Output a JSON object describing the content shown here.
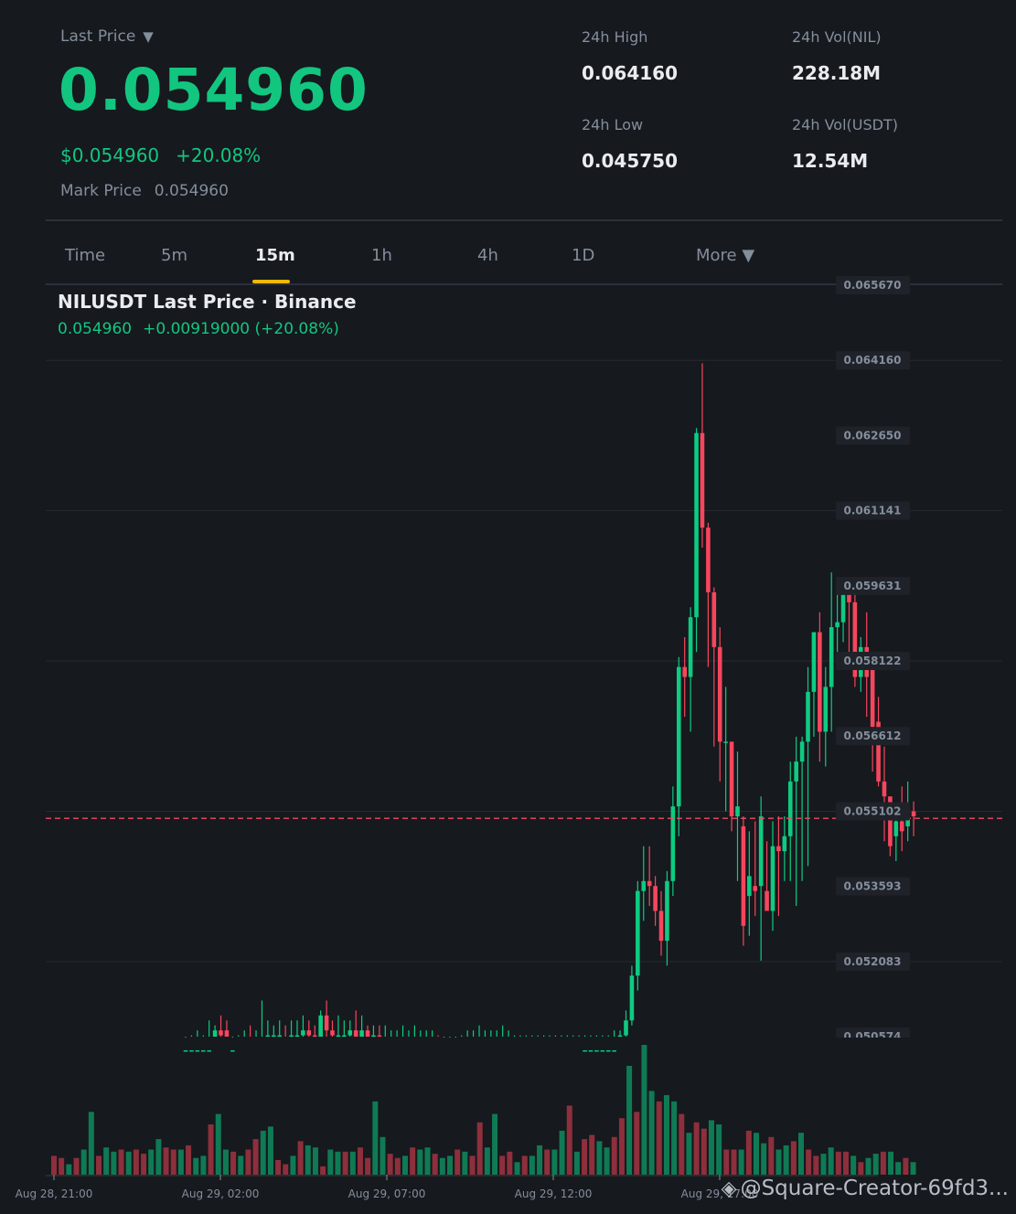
{
  "header": {
    "last_price_label": "Last Price",
    "last_price_caret": "▼",
    "last_price": "0.054960",
    "usd_price": "$0.054960",
    "change_pct": "+20.08%",
    "mark_label": "Mark Price",
    "mark_value": "0.054960",
    "stats": [
      {
        "label": "24h High",
        "value": "0.064160"
      },
      {
        "label": "24h Vol(NIL)",
        "value": "228.18M"
      },
      {
        "label": "24h Low",
        "value": "0.045750"
      },
      {
        "label": "24h Vol(USDT)",
        "value": "12.54M"
      }
    ]
  },
  "tabs": [
    {
      "label": "Time"
    },
    {
      "label": "5m"
    },
    {
      "label": "15m"
    },
    {
      "label": "1h"
    },
    {
      "label": "4h"
    },
    {
      "label": "1D"
    },
    {
      "label": "More ▼"
    }
  ],
  "active_tab": "15m",
  "chart": {
    "title": "NILUSDT Last Price · Binance",
    "last": "0.054960",
    "change": "+0.00919000 (+20.08%)"
  },
  "watermark": "@Square-Creator-69fd3...",
  "colors": {
    "up": "#0ecb81",
    "down": "#f6465d",
    "bg": "#16191e",
    "accent": "#f0b90b",
    "vol_up": "#0f7a54",
    "vol_down": "#8e2f3c"
  },
  "chart_data": {
    "type": "candlestick",
    "price_ticks": [
      "0.065670",
      "0.064160",
      "0.062650",
      "0.061141",
      "0.059631",
      "0.058122",
      "0.056612",
      "0.055102",
      "0.053593",
      "0.052083",
      "0.050574"
    ],
    "price_range": [
      0.050574,
      0.06567
    ],
    "current_price": 0.05496,
    "time_ticks": [
      "Aug 28, 21:00",
      "Aug 29, 02:00",
      "Aug 29, 07:00",
      "Aug 29, 12:00",
      "Aug 29, 17:00"
    ],
    "candles": [
      [
        0.0503,
        0.0503,
        0.0505,
        0.0501
      ],
      [
        0.0503,
        0.0503,
        0.0506,
        0.0501
      ],
      [
        0.0503,
        0.0503,
        0.0507,
        0.0501
      ],
      [
        0.0503,
        0.0503,
        0.0506,
        0.0501
      ],
      [
        0.0503,
        0.0503,
        0.0509,
        0.0502
      ],
      [
        0.0502,
        0.0507,
        0.0508,
        0.0501
      ],
      [
        0.0507,
        0.0506,
        0.051,
        0.0503
      ],
      [
        0.0507,
        0.0503,
        0.0509,
        0.0501
      ],
      [
        0.0503,
        0.0503,
        0.0505,
        0.0501
      ],
      [
        0.0503,
        0.0504,
        0.0506,
        0.0501
      ],
      [
        0.0504,
        0.0505,
        0.0507,
        0.0502
      ],
      [
        0.0505,
        0.0504,
        0.0508,
        0.0502
      ],
      [
        0.0504,
        0.0505,
        0.0507,
        0.0502
      ],
      [
        0.0505,
        0.0505,
        0.0513,
        0.0502
      ],
      [
        0.0505,
        0.0506,
        0.0509,
        0.0504
      ],
      [
        0.0506,
        0.0506,
        0.0508,
        0.0504
      ],
      [
        0.0506,
        0.0506,
        0.0509,
        0.0503
      ],
      [
        0.0505,
        0.0503,
        0.0508,
        0.0502
      ],
      [
        0.0503,
        0.0506,
        0.0509,
        0.0503
      ],
      [
        0.0506,
        0.0506,
        0.0509,
        0.0504
      ],
      [
        0.0506,
        0.0507,
        0.051,
        0.0505
      ],
      [
        0.0507,
        0.0506,
        0.0509,
        0.0503
      ],
      [
        0.0506,
        0.0503,
        0.0508,
        0.0502
      ],
      [
        0.0502,
        0.051,
        0.0511,
        0.0502
      ],
      [
        0.051,
        0.0507,
        0.0513,
        0.0503
      ],
      [
        0.0507,
        0.0506,
        0.0509,
        0.0504
      ],
      [
        0.0505,
        0.0506,
        0.051,
        0.0505
      ],
      [
        0.0506,
        0.0506,
        0.0509,
        0.0503
      ],
      [
        0.0506,
        0.0507,
        0.0509,
        0.0504
      ],
      [
        0.0507,
        0.0505,
        0.0511,
        0.0504
      ],
      [
        0.0505,
        0.0507,
        0.051,
        0.0503
      ],
      [
        0.0507,
        0.0505,
        0.0508,
        0.0503
      ],
      [
        0.0505,
        0.0506,
        0.0508,
        0.0503
      ],
      [
        0.0506,
        0.0505,
        0.0508,
        0.0503
      ],
      [
        0.0505,
        0.0505,
        0.0508,
        0.0503
      ],
      [
        0.0505,
        0.0505,
        0.0507,
        0.0503
      ],
      [
        0.0505,
        0.0505,
        0.0507,
        0.0503
      ],
      [
        0.0505,
        0.0505,
        0.0508,
        0.0503
      ],
      [
        0.0505,
        0.0505,
        0.0507,
        0.0503
      ],
      [
        0.0505,
        0.0505,
        0.0508,
        0.0503
      ],
      [
        0.0505,
        0.0505,
        0.0507,
        0.0503
      ],
      [
        0.0505,
        0.0505,
        0.0507,
        0.0503
      ],
      [
        0.0505,
        0.0505,
        0.0507,
        0.0503
      ],
      [
        0.0505,
        0.0504,
        0.0506,
        0.0502
      ],
      [
        0.0504,
        0.0504,
        0.0505,
        0.0503
      ],
      [
        0.0504,
        0.0504,
        0.0505,
        0.0503
      ],
      [
        0.0504,
        0.0504,
        0.0505,
        0.0503
      ],
      [
        0.0504,
        0.0505,
        0.0506,
        0.0503
      ],
      [
        0.0505,
        0.0505,
        0.0507,
        0.0503
      ],
      [
        0.0505,
        0.0505,
        0.0507,
        0.0503
      ],
      [
        0.0505,
        0.0505,
        0.0508,
        0.0503
      ],
      [
        0.0505,
        0.0505,
        0.0507,
        0.0503
      ],
      [
        0.0505,
        0.0505,
        0.0507,
        0.0503
      ],
      [
        0.0505,
        0.0505,
        0.0507,
        0.0503
      ],
      [
        0.0505,
        0.0505,
        0.0508,
        0.0503
      ],
      [
        0.0505,
        0.0505,
        0.0507,
        0.0503
      ],
      [
        0.0505,
        0.0505,
        0.0506,
        0.0503
      ],
      [
        0.0505,
        0.0505,
        0.0506,
        0.0503
      ],
      [
        0.0505,
        0.0505,
        0.0506,
        0.0503
      ],
      [
        0.0505,
        0.0505,
        0.0506,
        0.0503
      ],
      [
        0.0505,
        0.0505,
        0.0506,
        0.0503
      ],
      [
        0.0505,
        0.0505,
        0.0506,
        0.0503
      ],
      [
        0.0505,
        0.0505,
        0.0506,
        0.0503
      ],
      [
        0.0505,
        0.0505,
        0.0506,
        0.0503
      ],
      [
        0.0505,
        0.0505,
        0.0506,
        0.0503
      ],
      [
        0.0505,
        0.0505,
        0.0506,
        0.0503
      ],
      [
        0.0505,
        0.0505,
        0.0506,
        0.0503
      ],
      [
        0.0505,
        0.0505,
        0.0506,
        0.0503
      ],
      [
        0.0503,
        0.0503,
        0.0506,
        0.0503
      ],
      [
        0.0503,
        0.0503,
        0.0506,
        0.0503
      ],
      [
        0.0503,
        0.0503,
        0.0506,
        0.0503
      ],
      [
        0.0503,
        0.0503,
        0.0506,
        0.0503
      ],
      [
        0.0503,
        0.0503,
        0.0506,
        0.0503
      ],
      [
        0.0503,
        0.0503,
        0.0507,
        0.0502
      ],
      [
        0.0503,
        0.0506,
        0.0507,
        0.0503
      ],
      [
        0.0506,
        0.0509,
        0.0511,
        0.0505
      ],
      [
        0.0509,
        0.0518,
        0.052,
        0.0508
      ],
      [
        0.0518,
        0.0535,
        0.0537,
        0.0515
      ],
      [
        0.0535,
        0.0537,
        0.0544,
        0.0529
      ],
      [
        0.0537,
        0.0536,
        0.0544,
        0.0532
      ],
      [
        0.0536,
        0.0531,
        0.0538,
        0.0528
      ],
      [
        0.0531,
        0.0525,
        0.0535,
        0.0522
      ],
      [
        0.0525,
        0.0537,
        0.0539,
        0.052
      ],
      [
        0.0537,
        0.0552,
        0.0556,
        0.0534
      ],
      [
        0.0552,
        0.058,
        0.0582,
        0.0546
      ],
      [
        0.058,
        0.0578,
        0.0586,
        0.057
      ],
      [
        0.0578,
        0.059,
        0.0592,
        0.0567
      ],
      [
        0.059,
        0.0627,
        0.0628,
        0.0583
      ],
      [
        0.0627,
        0.0608,
        0.0641,
        0.0604
      ],
      [
        0.0608,
        0.0595,
        0.0609,
        0.058
      ],
      [
        0.0595,
        0.0584,
        0.0596,
        0.0564
      ],
      [
        0.0584,
        0.0565,
        0.0588,
        0.0557
      ],
      [
        0.0565,
        0.0565,
        0.0576,
        0.0551
      ],
      [
        0.0565,
        0.055,
        0.0565,
        0.0547
      ],
      [
        0.055,
        0.0552,
        0.0563,
        0.0537
      ],
      [
        0.0548,
        0.0528,
        0.055,
        0.0524
      ],
      [
        0.0534,
        0.0538,
        0.0547,
        0.0526
      ],
      [
        0.0536,
        0.0535,
        0.0549,
        0.053
      ],
      [
        0.0536,
        0.055,
        0.0554,
        0.0521
      ],
      [
        0.0535,
        0.0531,
        0.0545,
        0.0532
      ],
      [
        0.0531,
        0.0544,
        0.0549,
        0.0527
      ],
      [
        0.0544,
        0.0543,
        0.055,
        0.053
      ],
      [
        0.0543,
        0.0546,
        0.055,
        0.0537
      ],
      [
        0.0546,
        0.0557,
        0.0561,
        0.0537
      ],
      [
        0.0557,
        0.0561,
        0.0566,
        0.0532
      ],
      [
        0.0561,
        0.0565,
        0.0566,
        0.0537
      ],
      [
        0.0565,
        0.0575,
        0.058,
        0.054
      ],
      [
        0.0575,
        0.0587,
        0.0587,
        0.0566
      ],
      [
        0.0587,
        0.0567,
        0.0591,
        0.0561
      ],
      [
        0.0567,
        0.0576,
        0.058,
        0.056
      ],
      [
        0.0576,
        0.0588,
        0.0599,
        0.0567
      ],
      [
        0.0588,
        0.0589,
        0.0596,
        0.0581
      ],
      [
        0.0589,
        0.0596,
        0.0598,
        0.0585
      ],
      [
        0.0596,
        0.0593,
        0.0598,
        0.0581
      ],
      [
        0.0593,
        0.0578,
        0.0597,
        0.0576
      ],
      [
        0.0578,
        0.0584,
        0.0586,
        0.0575
      ],
      [
        0.0584,
        0.0578,
        0.0591,
        0.057
      ],
      [
        0.058,
        0.0568,
        0.0582,
        0.0559
      ],
      [
        0.0569,
        0.0557,
        0.0574,
        0.0556
      ],
      [
        0.0557,
        0.0554,
        0.0564,
        0.0545
      ],
      [
        0.0554,
        0.0544,
        0.0553,
        0.0542
      ],
      [
        0.0546,
        0.0549,
        0.0552,
        0.0541
      ],
      [
        0.0549,
        0.0547,
        0.0556,
        0.0543
      ],
      [
        0.0548,
        0.0551,
        0.0557,
        0.0545
      ],
      [
        0.0551,
        0.055,
        0.0553,
        0.0546
      ]
    ],
    "volumes": [
      [
        9,
        1
      ],
      [
        8,
        0
      ],
      [
        5,
        1
      ],
      [
        8,
        1
      ],
      [
        12,
        1
      ],
      [
        30,
        0
      ],
      [
        9,
        1
      ],
      [
        13,
        1
      ],
      [
        11,
        0
      ],
      [
        12,
        1
      ],
      [
        11,
        1
      ],
      [
        12,
        0
      ],
      [
        10,
        1
      ],
      [
        12,
        1
      ],
      [
        17,
        1
      ],
      [
        13,
        1
      ],
      [
        12,
        1
      ],
      [
        12,
        1
      ],
      [
        14,
        1
      ],
      [
        8,
        1
      ],
      [
        9,
        1
      ],
      [
        24,
        1
      ],
      [
        29,
        1
      ],
      [
        12,
        1
      ],
      [
        11,
        1
      ],
      [
        9,
        1
      ],
      [
        12,
        1
      ],
      [
        17,
        1
      ],
      [
        21,
        1
      ],
      [
        23,
        1
      ],
      [
        7,
        1
      ],
      [
        5,
        1
      ],
      [
        9,
        1
      ],
      [
        16,
        1
      ],
      [
        14,
        1
      ],
      [
        13,
        1
      ],
      [
        4,
        1
      ],
      [
        12,
        1
      ],
      [
        11,
        1
      ],
      [
        11,
        1
      ],
      [
        11,
        1
      ],
      [
        13,
        1
      ],
      [
        8,
        1
      ],
      [
        35,
        1
      ],
      [
        18,
        1
      ],
      [
        10,
        1
      ],
      [
        8,
        1
      ],
      [
        9,
        1
      ],
      [
        13,
        1
      ],
      [
        12,
        1
      ],
      [
        13,
        1
      ],
      [
        10,
        1
      ],
      [
        8,
        1
      ],
      [
        9,
        1
      ],
      [
        12,
        1
      ],
      [
        11,
        1
      ],
      [
        9,
        1
      ],
      [
        25,
        1
      ],
      [
        13,
        1
      ],
      [
        29,
        1
      ],
      [
        9,
        1
      ],
      [
        11,
        1
      ],
      [
        6,
        1
      ],
      [
        9,
        1
      ],
      [
        9,
        1
      ],
      [
        14,
        1
      ],
      [
        12,
        1
      ],
      [
        12,
        1
      ],
      [
        21,
        1
      ],
      [
        33,
        1
      ],
      [
        11,
        1
      ],
      [
        17,
        1
      ],
      [
        19,
        1
      ],
      [
        16,
        1
      ],
      [
        13,
        1
      ],
      [
        18,
        1
      ],
      [
        27,
        1
      ],
      [
        52,
        1
      ],
      [
        30,
        1
      ],
      [
        62,
        1
      ],
      [
        40,
        1
      ],
      [
        35,
        1
      ],
      [
        38,
        1
      ],
      [
        35,
        1
      ],
      [
        29,
        1
      ],
      [
        20,
        1
      ],
      [
        25,
        1
      ],
      [
        22,
        1
      ],
      [
        26,
        1
      ],
      [
        24,
        1
      ],
      [
        12,
        1
      ],
      [
        12,
        1
      ],
      [
        12,
        1
      ],
      [
        21,
        1
      ],
      [
        20,
        1
      ],
      [
        15,
        1
      ],
      [
        18,
        1
      ],
      [
        12,
        1
      ],
      [
        14,
        1
      ],
      [
        16,
        1
      ],
      [
        20,
        1
      ],
      [
        12,
        1
      ],
      [
        9,
        1
      ],
      [
        10,
        1
      ],
      [
        13,
        1
      ],
      [
        11,
        1
      ],
      [
        11,
        1
      ],
      [
        9,
        1
      ],
      [
        6,
        1
      ],
      [
        8,
        1
      ],
      [
        10,
        1
      ],
      [
        11,
        1
      ],
      [
        11,
        1
      ],
      [
        6,
        1
      ],
      [
        8,
        1
      ],
      [
        6,
        1
      ]
    ]
  }
}
